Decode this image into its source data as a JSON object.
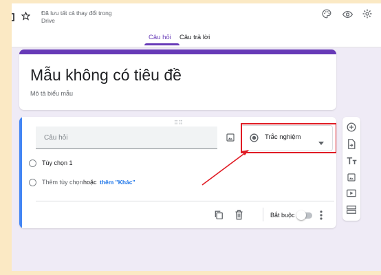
{
  "header": {
    "save_status_line1": "Đã lưu tất cả thay đổi trong",
    "save_status_line2": "Drive",
    "tabs": [
      {
        "label": "Câu hỏi",
        "active": true
      },
      {
        "label": "Câu trả lời",
        "active": false
      }
    ],
    "icons": [
      "folder-icon",
      "star-icon",
      "palette-icon",
      "preview-eye-icon",
      "settings-gear-icon"
    ]
  },
  "form": {
    "title": "Mẫu không có tiêu đề",
    "description": "Mô tả biểu mẫu"
  },
  "question": {
    "placeholder": "Câu hỏi",
    "type_selected": "Trắc nghiệm",
    "options": [
      {
        "label": "Tùy chọn 1"
      }
    ],
    "add_option_label": "Thêm tùy chọn",
    "or_label": "hoặc",
    "add_other_label": "thêm \"Khác\"",
    "required_label": "Bắt buộc",
    "required": false
  },
  "side_toolbar": [
    "add-question-icon",
    "import-questions-icon",
    "add-title-icon",
    "add-image-icon",
    "add-video-icon",
    "add-section-icon"
  ],
  "colors": {
    "accent": "#673ab7",
    "focus_bar": "#4285f4",
    "annotation": "#e01b24",
    "link": "#1a73e8",
    "background": "#efebf6"
  }
}
